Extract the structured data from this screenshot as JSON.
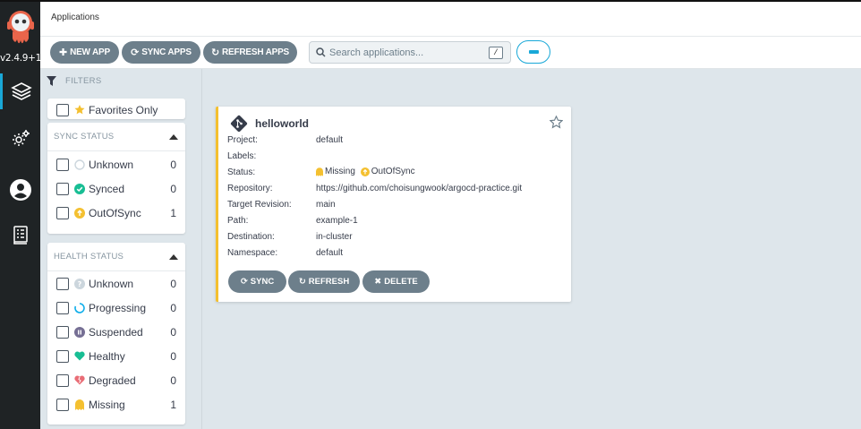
{
  "nav": {
    "version": "v2.4.9+1",
    "items": [
      "applications-icon",
      "settings-icon",
      "user-icon",
      "docs-icon"
    ]
  },
  "header": {
    "title": "Applications"
  },
  "toolbar": {
    "new_app": "NEW APP",
    "sync_apps": "SYNC APPS",
    "refresh_apps": "REFRESH APPS",
    "search_placeholder": "Search applications...",
    "search_shortcut": "/"
  },
  "filters": {
    "label": "FILTERS",
    "favorites": "Favorites Only",
    "sync_status": {
      "title": "SYNC STATUS",
      "items": [
        {
          "label": "Unknown",
          "count": "0",
          "icon": "unknown-circle-icon"
        },
        {
          "label": "Synced",
          "count": "0",
          "icon": "check-circle-icon"
        },
        {
          "label": "OutOfSync",
          "count": "1",
          "icon": "arrow-up-circle-icon"
        }
      ]
    },
    "health_status": {
      "title": "HEALTH STATUS",
      "items": [
        {
          "label": "Unknown",
          "count": "0",
          "icon": "question-circle-icon"
        },
        {
          "label": "Progressing",
          "count": "0",
          "icon": "spinner-icon"
        },
        {
          "label": "Suspended",
          "count": "0",
          "icon": "pause-circle-icon"
        },
        {
          "label": "Healthy",
          "count": "0",
          "icon": "heart-icon"
        },
        {
          "label": "Degraded",
          "count": "0",
          "icon": "heart-broken-icon"
        },
        {
          "label": "Missing",
          "count": "1",
          "icon": "ghost-icon"
        }
      ]
    }
  },
  "app": {
    "name": "helloworld",
    "fields": [
      {
        "key": "Project:",
        "value": "default"
      },
      {
        "key": "Labels:",
        "value": ""
      },
      {
        "key": "Status:",
        "value": ""
      },
      {
        "key": "Repository:",
        "value": "https://github.com/choisungwook/argocd-practice.git"
      },
      {
        "key": "Target Revision:",
        "value": "main"
      },
      {
        "key": "Path:",
        "value": "example-1"
      },
      {
        "key": "Destination:",
        "value": "in-cluster"
      },
      {
        "key": "Namespace:",
        "value": "default"
      }
    ],
    "health": "Missing",
    "sync": "OutOfSync",
    "buttons": {
      "sync": "SYNC",
      "refresh": "REFRESH",
      "delete": "DELETE"
    }
  },
  "colors": {
    "accent": "#19a8d8",
    "button": "#6d7f8b",
    "missing": "#f4c030",
    "out_of_sync": "#f4c030",
    "synced": "#18be94",
    "healthy": "#18be94",
    "degraded": "#e96d76"
  }
}
